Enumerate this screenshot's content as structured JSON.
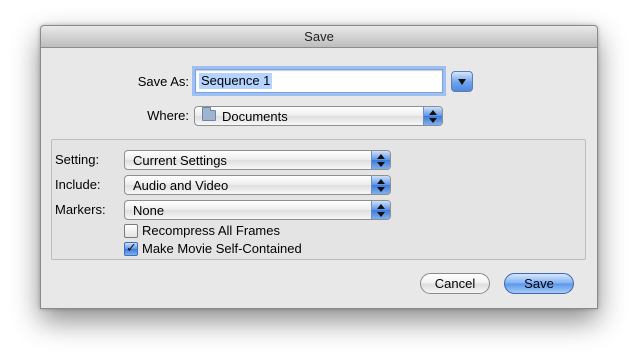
{
  "window": {
    "title": "Save"
  },
  "save_as": {
    "label": "Save As:",
    "value": "Sequence 1"
  },
  "where": {
    "label": "Where:",
    "value": "Documents",
    "icon": "folder-icon"
  },
  "options": {
    "setting": {
      "label": "Setting:",
      "value": "Current Settings"
    },
    "include": {
      "label": "Include:",
      "value": "Audio and Video"
    },
    "markers": {
      "label": "Markers:",
      "value": "None"
    },
    "recompress": {
      "label": "Recompress All Frames",
      "checked": false
    },
    "self_contained": {
      "label": "Make Movie Self-Contained",
      "checked": true
    }
  },
  "buttons": {
    "cancel": "Cancel",
    "save": "Save"
  },
  "colors": {
    "accent": "#5a95ea",
    "window_bg": "#e8e8e8"
  }
}
